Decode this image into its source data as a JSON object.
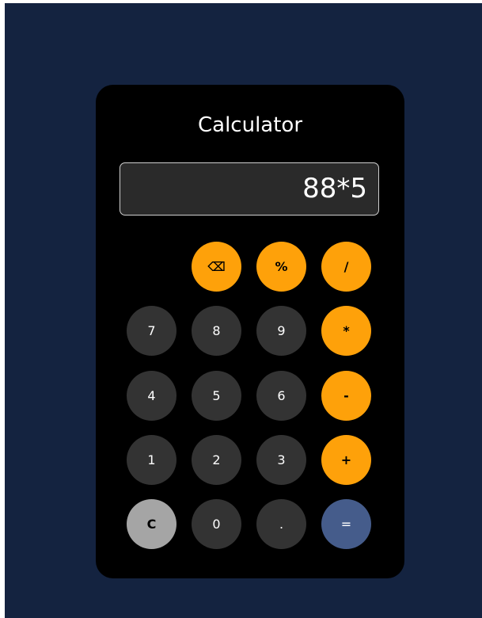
{
  "calculator": {
    "title": "Calculator",
    "display_value": "88*5",
    "buttons": {
      "backspace": "⌫",
      "percent": "%",
      "divide": "/",
      "seven": "7",
      "eight": "8",
      "nine": "9",
      "multiply": "*",
      "four": "4",
      "five": "5",
      "six": "6",
      "subtract": "-",
      "one": "1",
      "two": "2",
      "three": "3",
      "add": "+",
      "clear": "C",
      "zero": "0",
      "decimal": ".",
      "equals": "="
    }
  },
  "colors": {
    "background": "#142340",
    "panel": "#000000",
    "number_button": "#333333",
    "operator_button": "#fea10a",
    "clear_button": "#a5a5a5",
    "equals_button": "#455c8b"
  }
}
